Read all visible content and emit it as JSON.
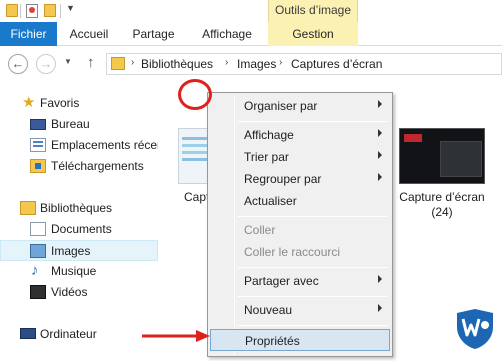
{
  "ribbon": {
    "contextual_group": "Outils d’image",
    "tabs": [
      "Fichier",
      "Accueil",
      "Partage",
      "Affichage",
      "Gestion"
    ]
  },
  "address": {
    "crumbs": [
      "Bibliothèques",
      "Images",
      "Captures d’écran"
    ]
  },
  "nav": {
    "items": [
      {
        "label": "Favoris",
        "icon": "star-icon"
      },
      {
        "label": "Bureau",
        "icon": "desktop-icon"
      },
      {
        "label": "Emplacements récer",
        "icon": "recent-places-icon"
      },
      {
        "label": "Téléchargements",
        "icon": "downloads-icon"
      },
      {
        "label": "Bibliothèques",
        "icon": "libraries-icon"
      },
      {
        "label": "Documents",
        "icon": "documents-icon"
      },
      {
        "label": "Images",
        "icon": "images-icon"
      },
      {
        "label": "Musique",
        "icon": "music-icon"
      },
      {
        "label": "Vidéos",
        "icon": "videos-icon"
      },
      {
        "label": "Ordinateur",
        "icon": "computer-icon"
      }
    ]
  },
  "files": {
    "left_label": "Capt",
    "right_label_line1": "Capture d’écran",
    "right_label_line2": "(24)"
  },
  "menu": {
    "items": [
      {
        "label": "Organiser par",
        "submenu": true,
        "disabled": false
      },
      {
        "label": "Affichage",
        "submenu": true,
        "disabled": false
      },
      {
        "label": "Trier par",
        "submenu": true,
        "disabled": false
      },
      {
        "label": "Regrouper par",
        "submenu": true,
        "disabled": false
      },
      {
        "label": "Actualiser",
        "submenu": false,
        "disabled": false
      },
      {
        "label": "Coller",
        "submenu": false,
        "disabled": true
      },
      {
        "label": "Coller le raccourci",
        "submenu": false,
        "disabled": true
      },
      {
        "label": "Partager avec",
        "submenu": true,
        "disabled": false
      },
      {
        "label": "Nouveau",
        "submenu": true,
        "disabled": false
      },
      {
        "label": "Propriétés",
        "submenu": false,
        "disabled": false,
        "highlighted": true
      }
    ]
  },
  "colors": {
    "fichier_tab": "#1979ca",
    "contextual_tab": "#fbf1b3",
    "annotation_red": "#e0201d",
    "menu_highlight": "#d8e6f2"
  }
}
